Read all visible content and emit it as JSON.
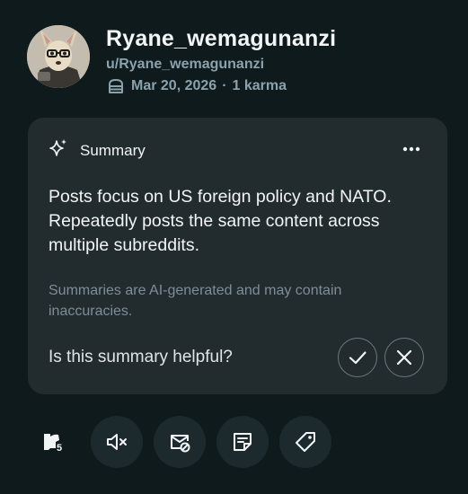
{
  "profile": {
    "username": "Ryane_wemagunanzi",
    "handle": "u/Ryane_wemagunanzi",
    "cake_day": "Mar 20, 2026",
    "separator": "·",
    "karma": "1 karma"
  },
  "summary": {
    "title": "Summary",
    "text": "Posts focus on US foreign policy and NATO. Repeatedly posts the same content across multiple subreddits.",
    "disclaimer": "Summaries are AI-generated and may contain inaccuracies.",
    "feedback_prompt": "Is this summary helpful?"
  },
  "actions": {
    "badge_count": "5",
    "icons": [
      "badge-icon",
      "mute-icon",
      "message-block-icon",
      "note-icon",
      "tag-icon"
    ]
  },
  "colors": {
    "background": "#0e1a1c",
    "card": "#222c2f",
    "muted_text": "#8ba2ad",
    "action_bg": "#1c2a2d"
  }
}
